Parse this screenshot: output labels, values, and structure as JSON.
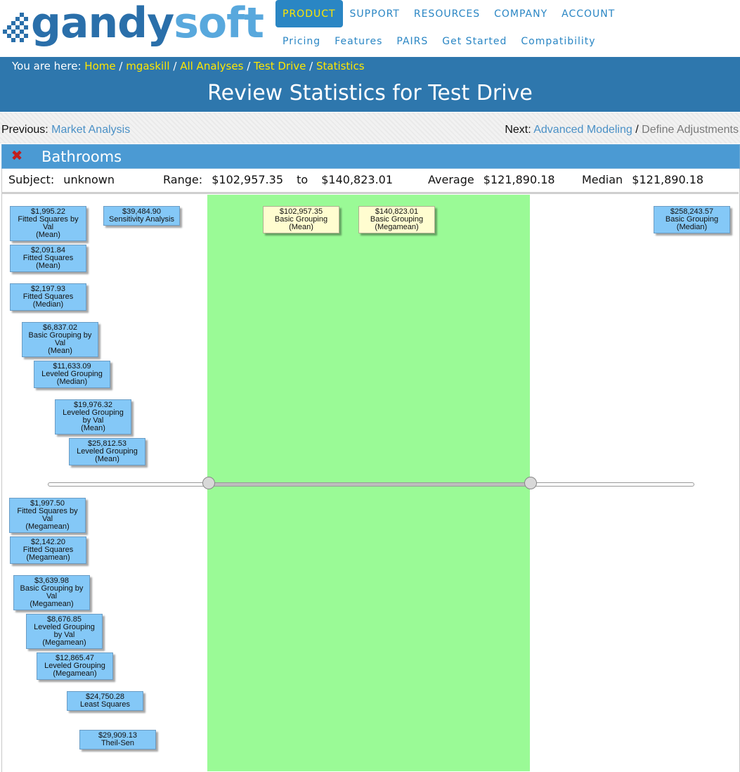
{
  "logo": {
    "part1": "gandy",
    "part2": "soft"
  },
  "nav": {
    "main": [
      "PRODUCT",
      "SUPPORT",
      "RESOURCES",
      "COMPANY",
      "ACCOUNT"
    ],
    "sub": [
      "Pricing",
      "Features",
      "PAIRS",
      "Get Started",
      "Compatibility"
    ]
  },
  "breadcrumb": {
    "prefix": "You are here:",
    "items": [
      "Home",
      "mgaskill",
      "All Analyses",
      "Test Drive",
      "Statistics"
    ]
  },
  "page_title": "Review Statistics for Test Drive",
  "prev_next": {
    "prev_label": "Previous:",
    "prev_link": "Market Analysis",
    "next_label": "Next:",
    "next_link": "Advanced Modeling",
    "next_extra": "Define Adjustments"
  },
  "panel": {
    "title": "Bathrooms",
    "subject_label": "Subject:",
    "subject_value": "unknown",
    "range_label": "Range:",
    "range_low": "$102,957.35",
    "range_to": "to",
    "range_high": "$140,823.01",
    "average_label": "Average",
    "average_value": "$121,890.18",
    "median_label": "Median",
    "median_value": "$121,890.18"
  },
  "labels": [
    {
      "value": "$1,995.22",
      "name": "Fitted Squares by Val",
      "stat": "(Mean)"
    },
    {
      "value": "$39,484.90",
      "name": "Sensitivity Analysis",
      "stat": ""
    },
    {
      "value": "$102,957.35",
      "name": "Basic Grouping",
      "stat": "(Mean)"
    },
    {
      "value": "$140,823.01",
      "name": "Basic Grouping",
      "stat": "(Megamean)"
    },
    {
      "value": "$258,243.57",
      "name": "Basic Grouping",
      "stat": "(Median)"
    },
    {
      "value": "$2,091.84",
      "name": "Fitted Squares",
      "stat": "(Mean)"
    },
    {
      "value": "$2,197.93",
      "name": "Fitted Squares",
      "stat": "(Median)"
    },
    {
      "value": "$6,837.02",
      "name": "Basic Grouping by Val",
      "stat": "(Mean)"
    },
    {
      "value": "$11,633.09",
      "name": "Leveled Grouping",
      "stat": "(Median)"
    },
    {
      "value": "$19,976.32",
      "name": "Leveled Grouping by Val",
      "stat": "(Mean)"
    },
    {
      "value": "$25,812.53",
      "name": "Leveled Grouping",
      "stat": "(Mean)"
    },
    {
      "value": "$1,997.50",
      "name": "Fitted Squares by Val",
      "stat": "(Megamean)"
    },
    {
      "value": "$2,142.20",
      "name": "Fitted Squares",
      "stat": "(Megamean)"
    },
    {
      "value": "$3,639.98",
      "name": "Basic Grouping by Val",
      "stat": "(Megamean)"
    },
    {
      "value": "$8,676.85",
      "name": "Leveled Grouping by Val",
      "stat": "(Megamean)"
    },
    {
      "value": "$12,865.47",
      "name": "Leveled Grouping",
      "stat": "(Megamean)"
    },
    {
      "value": "$24,750.28",
      "name": "Least Squares",
      "stat": ""
    },
    {
      "value": "$29,909.13",
      "name": "Theil-Sen",
      "stat": ""
    }
  ],
  "colors": {
    "brand": "#2e77ad",
    "link_yellow": "#ffe600",
    "range_band": "#9afa96",
    "label_blue": "#84c8f7",
    "label_cream": "#fffdd0"
  }
}
